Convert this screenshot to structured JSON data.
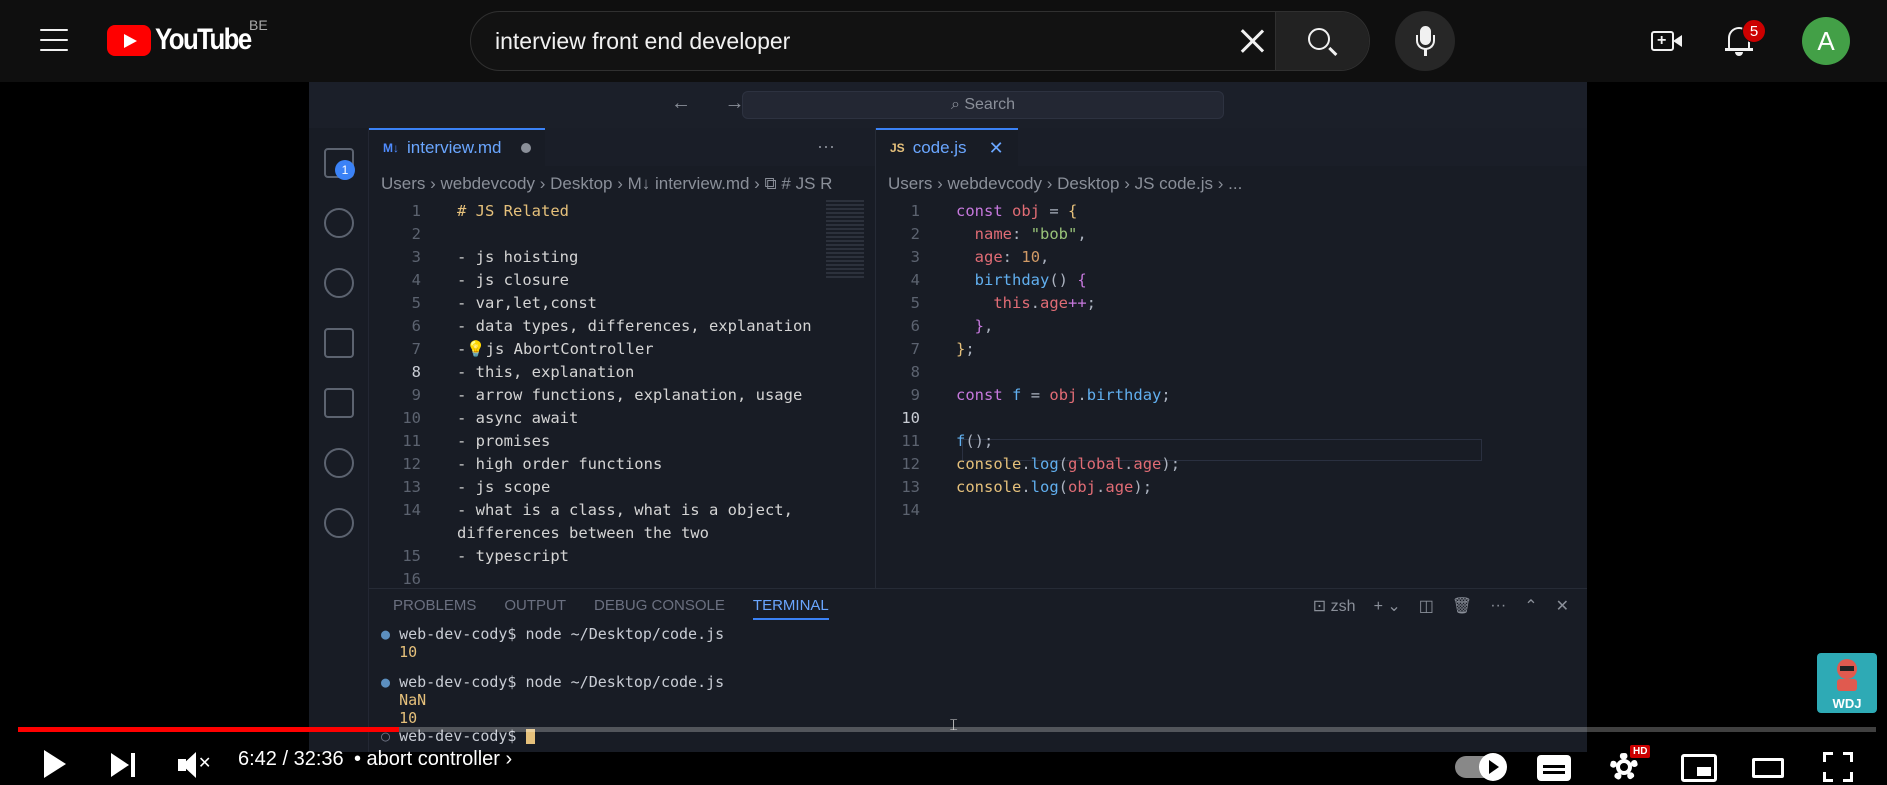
{
  "header": {
    "logo_text": "YouTube",
    "country_code": "BE",
    "search_value": "interview front end developer",
    "notification_count": "5",
    "avatar_letter": "A"
  },
  "vscode": {
    "command_search": "Search",
    "activity_badge": "1",
    "left_tab": {
      "icon": "M↓",
      "label": "interview.md"
    },
    "right_tab": {
      "icon": "JS",
      "label": "code.js"
    },
    "left_crumbs": "Users  ›  webdevcody  ›  Desktop  ›  M↓ interview.md  ›  ⧉ # JS R",
    "right_crumbs": "Users  ›  webdevcody  ›  Desktop  ›  JS code.js  ›  ...",
    "md_lines": [
      {
        "n": "1",
        "t": "# JS Related"
      },
      {
        "n": "2",
        "t": ""
      },
      {
        "n": "3",
        "t": "- js hoisting"
      },
      {
        "n": "4",
        "t": "- js closure"
      },
      {
        "n": "5",
        "t": "- var,let,const"
      },
      {
        "n": "6",
        "t": "- data types, differences, explanation"
      },
      {
        "n": "7",
        "t": "-💡js AbortController"
      },
      {
        "n": "8",
        "t": "- this, explanation"
      },
      {
        "n": "9",
        "t": "- arrow functions, explanation, usage"
      },
      {
        "n": "10",
        "t": "- async await"
      },
      {
        "n": "11",
        "t": "- promises"
      },
      {
        "n": "12",
        "t": "- high order functions"
      },
      {
        "n": "13",
        "t": "- js scope"
      },
      {
        "n": "14",
        "t": "- what is a class, what is a object,"
      },
      {
        "n": "",
        "t": "differences between the two"
      },
      {
        "n": "15",
        "t": "- typescript"
      },
      {
        "n": "16",
        "t": ""
      }
    ],
    "js_line_numbers": [
      "1",
      "2",
      "3",
      "4",
      "5",
      "6",
      "7",
      "8",
      "9",
      "10",
      "11",
      "12",
      "13",
      "14"
    ],
    "panel_tabs": [
      "PROBLEMS",
      "OUTPUT",
      "DEBUG CONSOLE",
      "TERMINAL"
    ],
    "terminal_shell": "zsh",
    "terminal": {
      "prompt": "web-dev-cody$",
      "cmd": "node ~/Desktop/code.js",
      "out1": "10",
      "out2": "NaN",
      "out3": "10"
    }
  },
  "watermark": {
    "label": "WDJ"
  },
  "player": {
    "progress_fraction": 0.205,
    "time": "6:42 / 32:36",
    "chapter": "• abort controller  ›",
    "hd_badge": "HD"
  }
}
